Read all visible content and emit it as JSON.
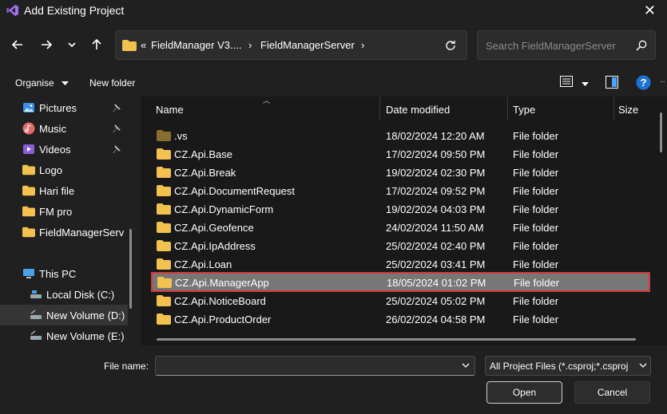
{
  "window": {
    "title": "Add Existing Project"
  },
  "address": {
    "overflow": "«",
    "crumbs": [
      "FieldManager V3....",
      "FieldManagerServer"
    ],
    "separator": "›"
  },
  "search": {
    "placeholder": "Search FieldManagerServer"
  },
  "commands": {
    "organise": "Organise",
    "new_folder": "New folder"
  },
  "sidebar": {
    "items": [
      {
        "label": "Pictures",
        "icon": "pictures-icon",
        "pinned": true
      },
      {
        "label": "Music",
        "icon": "music-icon",
        "pinned": true
      },
      {
        "label": "Videos",
        "icon": "videos-icon",
        "pinned": true
      },
      {
        "label": "Logo",
        "icon": "folder-icon"
      },
      {
        "label": "Hari file",
        "icon": "folder-icon"
      },
      {
        "label": "FM pro",
        "icon": "folder-icon"
      },
      {
        "label": "FieldManagerServ",
        "icon": "folder-icon"
      },
      {
        "label": "This PC",
        "icon": "this-pc-icon"
      },
      {
        "label": "Local Disk (C:)",
        "icon": "drive-icon"
      },
      {
        "label": "New Volume (D:)",
        "icon": "drive-icon",
        "selected": true
      },
      {
        "label": "New Volume (E:)",
        "icon": "drive-icon"
      }
    ]
  },
  "columns": {
    "name": "Name",
    "date": "Date modified",
    "type": "Type",
    "size": "Size"
  },
  "files": [
    {
      "name": ".vs",
      "date": "18/02/2024 12:20 AM",
      "type": "File folder",
      "hidden": true
    },
    {
      "name": "CZ.Api.Base",
      "date": "17/02/2024 09:50 PM",
      "type": "File folder"
    },
    {
      "name": "CZ.Api.Break",
      "date": "19/02/2024 02:30 PM",
      "type": "File folder"
    },
    {
      "name": "CZ.Api.DocumentRequest",
      "date": "17/02/2024 09:52 PM",
      "type": "File folder"
    },
    {
      "name": "CZ.Api.DynamicForm",
      "date": "19/02/2024 04:03 PM",
      "type": "File folder"
    },
    {
      "name": "CZ.Api.Geofence",
      "date": "24/02/2024 11:50 AM",
      "type": "File folder"
    },
    {
      "name": "CZ.Api.IpAddress",
      "date": "25/02/2024 02:40 PM",
      "type": "File folder"
    },
    {
      "name": "CZ.Api.Loan",
      "date": "25/02/2024 03:41 PM",
      "type": "File folder"
    },
    {
      "name": "CZ.Api.ManagerApp",
      "date": "18/05/2024 01:02 PM",
      "type": "File folder",
      "selected": true
    },
    {
      "name": "CZ.Api.NoticeBoard",
      "date": "25/02/2024 05:02 PM",
      "type": "File folder"
    },
    {
      "name": "CZ.Api.ProductOrder",
      "date": "26/02/2024 04:58 PM",
      "type": "File folder"
    }
  ],
  "footer": {
    "file_name_label": "File name:",
    "file_name_value": "",
    "file_type": "All Project Files (*.csproj;*.csproj",
    "open": "Open",
    "cancel": "Cancel"
  },
  "colors": {
    "folder": "#f2c14e",
    "folder_dim": "#8a6e2f",
    "selection_border": "#d73a3a",
    "help": "#1e73d2"
  }
}
